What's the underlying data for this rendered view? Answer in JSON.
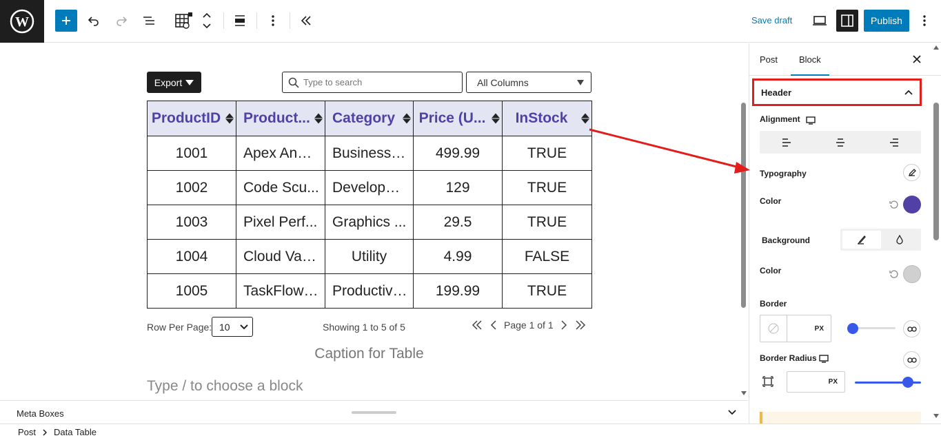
{
  "toolbar": {
    "save_draft": "Save draft",
    "publish": "Publish",
    "icons": [
      "wordpress-logo-icon",
      "plus-icon",
      "undo-icon",
      "redo-icon",
      "list-view-icon",
      "data-table-block-icon",
      "chevron-up-down-icon",
      "align-icon",
      "vertical-dots-icon",
      "double-chevron-left-icon",
      "desktop-preview-icon",
      "sidebar-toggle-icon"
    ]
  },
  "table_controls": {
    "export_label": "Export",
    "search_placeholder": "Type to search",
    "column_filter": "All Columns"
  },
  "table": {
    "headers": [
      "ProductID",
      "Product...",
      "Category",
      "Price (U...",
      "InStock"
    ],
    "rows": [
      [
        "1001",
        "Apex Anal...",
        "Business I...",
        "499.99",
        "TRUE"
      ],
      [
        "1002",
        "Code Scu...",
        "Developm...",
        "129",
        "TRUE"
      ],
      [
        "1003",
        "Pixel Perf...",
        "Graphics ...",
        "29.5",
        "TRUE"
      ],
      [
        "1004",
        "Cloud Vau...",
        "Utility",
        "4.99",
        "FALSE"
      ],
      [
        "1005",
        "TaskFlow ...",
        "Productivi...",
        "199.99",
        "TRUE"
      ]
    ],
    "header_color": "#5141a7",
    "header_background": "#e3e5f3"
  },
  "pagination": {
    "rows_per_page_label": "Row Per Page:",
    "rows_per_page_value": "10",
    "showing": "Showing 1 to 5 of 5",
    "page": "Page 1 of 1"
  },
  "caption": "Caption for Table",
  "block_placeholder": "Type / to choose a block",
  "meta_boxes": "Meta Boxes",
  "breadcrumb": [
    "Post",
    "Data Table"
  ],
  "sidebar": {
    "tabs": [
      "Post",
      "Block"
    ],
    "active_tab": "Block",
    "panel_title": "Header",
    "alignment_label": "Alignment",
    "typography_label": "Typography",
    "color_label": "Color",
    "text_color": "#5141a7",
    "background_label": "Background",
    "bg_color_label": "Color",
    "bg_color": "#d0d0d0",
    "border_label": "Border",
    "border_unit": "PX",
    "border_radius_label": "Border Radius",
    "radius_unit": "PX",
    "border_slider_fraction": 0.0,
    "radius_slider_fraction": 0.8
  }
}
